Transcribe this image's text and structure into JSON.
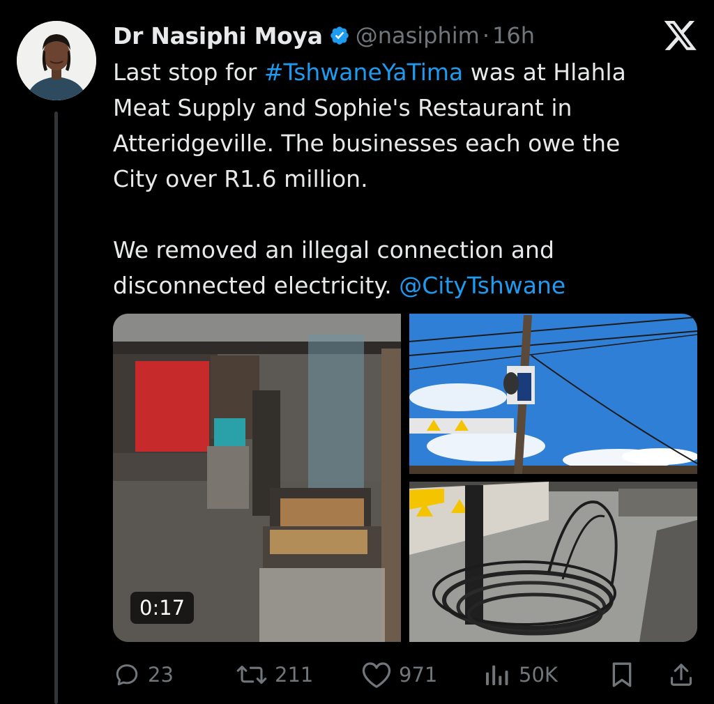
{
  "author": {
    "name": "Dr Nasiphi Moya",
    "handle": "@nasiphim",
    "separator": "·",
    "time": "16h",
    "avatar_icon": "profile-photo"
  },
  "tweet": {
    "lines": [
      {
        "pre": "Last stop for ",
        "link": "#TshwaneYaTima",
        "post": " was at Hlahla"
      },
      {
        "text": "Meat Supply and Sophie's Restaurant in"
      },
      {
        "text": "Atteridgeville. The businesses each owe the"
      },
      {
        "text": "City over R1.6 million."
      },
      {
        "text": "We removed an illegal connection and"
      },
      {
        "pre": "disconnected electricity. ",
        "link": "@CityTshwane",
        "post": ""
      }
    ]
  },
  "media": {
    "video_duration": "0:17",
    "images": [
      "video-street-braai",
      "power-pole-sky",
      "coiled-cable"
    ]
  },
  "actions": {
    "replies": "23",
    "reposts": "211",
    "likes": "971",
    "views": "50K"
  },
  "colors": {
    "background": "#000000",
    "text": "#e7e9ea",
    "muted": "#71767b",
    "link": "#1d9bf0",
    "verified": "#1d9bf0"
  }
}
